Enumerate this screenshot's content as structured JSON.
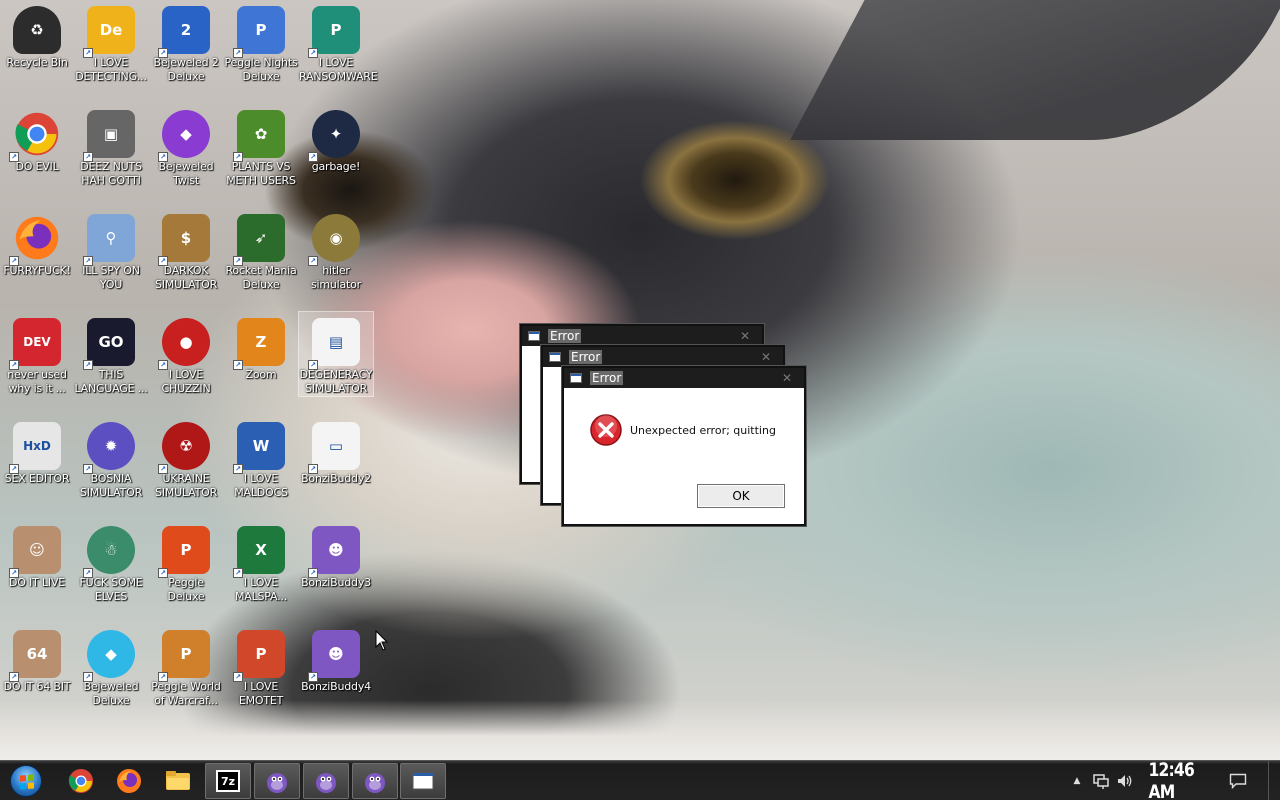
{
  "desktop": {
    "icons": [
      {
        "label": "Recycle Bin",
        "icon": "recycle-bin-icon"
      },
      {
        "label": "I LOVE DETECTING...",
        "icon": "detect-it-easy-icon"
      },
      {
        "label": "Bejeweled 2 Deluxe",
        "icon": "bejeweled-2-icon"
      },
      {
        "label": "Peggle Nights Deluxe",
        "icon": "peggle-nights-icon"
      },
      {
        "label": "I LOVE RANSOMWARE",
        "icon": "publisher-icon"
      },
      {
        "label": "DO EVIL",
        "icon": "chrome-icon"
      },
      {
        "label": "DEEZ NUTS HAH GOTTI",
        "icon": "stacked-windows-icon"
      },
      {
        "label": "Bejeweled Twist",
        "icon": "bejeweled-twist-icon"
      },
      {
        "label": "PLANTS VS METH USERS",
        "icon": "plants-vs-zombies-icon"
      },
      {
        "label": "garbage!",
        "icon": "garbage-icon"
      },
      {
        "label": "FURRYFUCK!",
        "icon": "firefox-icon"
      },
      {
        "label": "ILL SPY ON YOU",
        "icon": "network-spy-icon"
      },
      {
        "label": "DARKOK SIMULATOR",
        "icon": "money-bag-icon"
      },
      {
        "label": "Rocket Mania Deluxe",
        "icon": "rocket-mania-icon"
      },
      {
        "label": "hitler simulator",
        "icon": "coin-icon"
      },
      {
        "label": "never used why is it ...",
        "icon": "dev-cpp-icon"
      },
      {
        "label": "THIS LANGUAGE ...",
        "icon": "goland-icon"
      },
      {
        "label": "I LOVE CHUZZIN",
        "icon": "chuzzle-icon"
      },
      {
        "label": "Zoom",
        "icon": "zuma-icon"
      },
      {
        "label": "DEGENERACY SIMULATOR",
        "icon": "degeneracy-program-icon"
      },
      {
        "label": "SEX EDITOR",
        "icon": "hxd-editor-icon"
      },
      {
        "label": "BOSNIA SIMULATOR",
        "icon": "spiked-mine-icon"
      },
      {
        "label": "UKRAINE SIMULATOR",
        "icon": "radiation-icon"
      },
      {
        "label": "I LOVE MALDOCS",
        "icon": "word-icon"
      },
      {
        "label": "BonziBuddy2",
        "icon": "blank-program-icon"
      },
      {
        "label": "DO IT LIVE",
        "icon": "portrait-icon"
      },
      {
        "label": "FUCK SOME ELVES",
        "icon": "elf-globe-icon"
      },
      {
        "label": "Peggle Deluxe",
        "icon": "peggle-icon"
      },
      {
        "label": "I LOVE MALSPA...",
        "icon": "excel-icon"
      },
      {
        "label": "BonziBuddy3",
        "icon": "bonzi-buddy-icon"
      },
      {
        "label": "DO IT 64 BIT",
        "icon": "portrait-64-icon"
      },
      {
        "label": "Bejeweled Deluxe",
        "icon": "diamond-icon"
      },
      {
        "label": "Peggle World of Warcraf...",
        "icon": "peggle-wow-icon"
      },
      {
        "label": "I LOVE EMOTET",
        "icon": "powerpoint-icon"
      },
      {
        "label": "BonziBuddy4",
        "icon": "bonzi-buddy-icon"
      }
    ]
  },
  "dialogs": [
    {
      "title": "Error",
      "close": "✕"
    },
    {
      "title": "Error",
      "close": "✕"
    },
    {
      "title": "Error",
      "close": "✕",
      "message": "Unexpected error; quitting",
      "ok_label": "OK"
    }
  ],
  "taskbar": {
    "start": "start-orb-icon",
    "items": [
      {
        "icon": "chrome-icon",
        "active": false
      },
      {
        "icon": "firefox-icon",
        "active": false
      },
      {
        "icon": "file-explorer-icon",
        "active": false
      },
      {
        "icon": "7zip-icon",
        "label": "7z",
        "active": true
      },
      {
        "icon": "bonzi-buddy-icon",
        "active": true
      },
      {
        "icon": "bonzi-buddy-icon",
        "active": true
      },
      {
        "icon": "bonzi-buddy-icon",
        "active": true
      },
      {
        "icon": "blank-program-icon",
        "active": true
      }
    ],
    "tray": {
      "chevron": "▲",
      "clock": "12:46 AM"
    }
  },
  "colors": {
    "error_red": "#d9262c",
    "taskbar_bg": "#232323",
    "dialog_titlebar": "#1d1d1d"
  }
}
